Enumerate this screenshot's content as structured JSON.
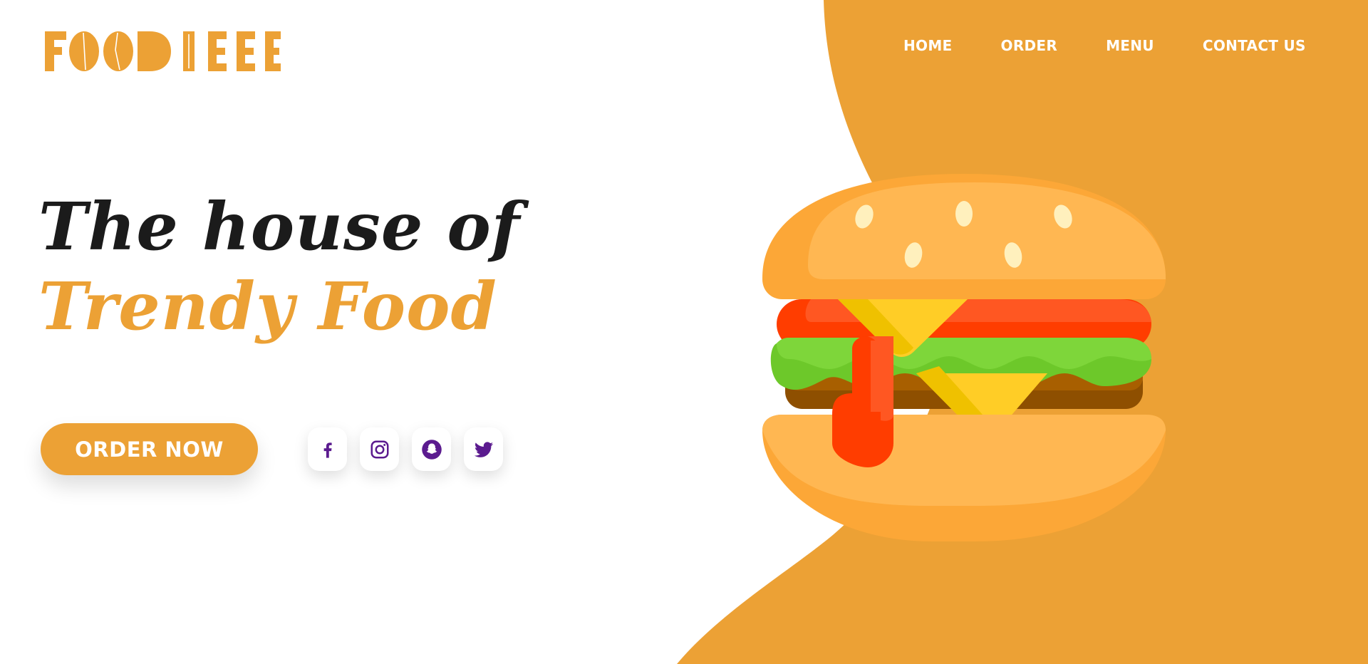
{
  "brand": {
    "logo_text": "FOODIEEE",
    "color": "#eca135"
  },
  "nav": {
    "items": [
      {
        "label": "HOME"
      },
      {
        "label": "ORDER"
      },
      {
        "label": "MENU"
      },
      {
        "label": "CONTACT US"
      }
    ]
  },
  "hero": {
    "line1": "The house of",
    "line2": "Trendy Food",
    "cta_label": "ORDER NOW"
  },
  "socials": [
    {
      "icon": "facebook-icon"
    },
    {
      "icon": "instagram-icon"
    },
    {
      "icon": "snapchat-icon"
    },
    {
      "icon": "twitter-icon"
    }
  ],
  "colors": {
    "accent": "#eca135",
    "heading_dark": "#1b1b1b",
    "social_icon": "#5b1b8f",
    "nav_text": "#ffffff"
  },
  "illustration": {
    "icon": "burger-illustration"
  }
}
